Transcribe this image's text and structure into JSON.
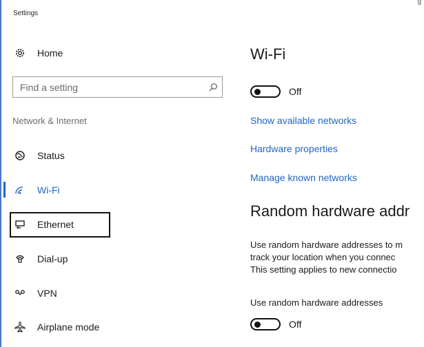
{
  "app": {
    "title": "Settings",
    "top_right_fragment": "g"
  },
  "nav": {
    "home_label": "Home",
    "search": {
      "placeholder": "Find a setting"
    },
    "section_label": "Network & Internet",
    "items": [
      {
        "label": "Status",
        "icon": "status-globe-icon"
      },
      {
        "label": "Wi-Fi",
        "icon": "wifi-icon",
        "selected": true
      },
      {
        "label": "Ethernet",
        "icon": "ethernet-icon",
        "highlighted": true
      },
      {
        "label": "Dial-up",
        "icon": "phone-icon"
      },
      {
        "label": "VPN",
        "icon": "vpn-icon"
      },
      {
        "label": "Airplane mode",
        "icon": "airplane-icon"
      }
    ]
  },
  "main": {
    "title": "Wi-Fi",
    "wifi_toggle": {
      "state": "Off"
    },
    "links": {
      "show_networks": "Show available networks",
      "hardware_properties": "Hardware properties",
      "manage_networks": "Manage known networks"
    },
    "random_hw": {
      "heading": "Random hardware addr",
      "description": [
        "Use random hardware addresses to m",
        "track your location when you connec",
        "This setting applies to new connectio"
      ],
      "setting_label": "Use random hardware addresses",
      "toggle_state": "Off"
    }
  },
  "colors": {
    "accent": "#1f64c8",
    "text": "#1a1a1a",
    "muted": "#6b6b6b"
  }
}
